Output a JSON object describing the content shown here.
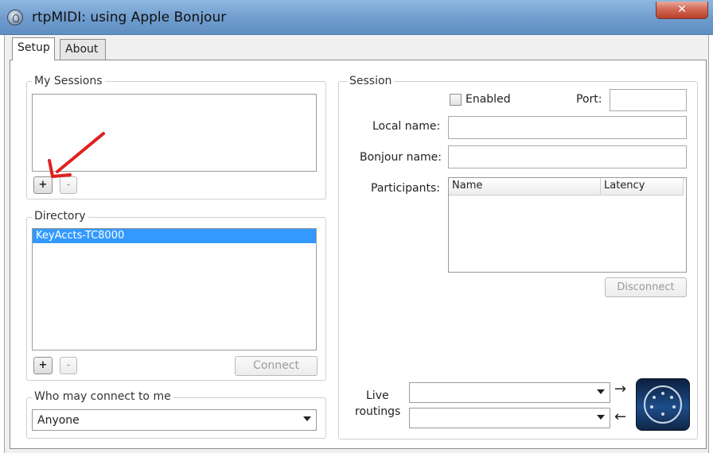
{
  "window": {
    "title": "rtpMIDI: using Apple Bonjour",
    "close_glyph": "✕"
  },
  "tabs": [
    {
      "label": "Setup",
      "active": true
    },
    {
      "label": "About",
      "active": false
    }
  ],
  "my_sessions": {
    "label": "My Sessions",
    "add_label": "+",
    "remove_label": "-",
    "items": []
  },
  "directory": {
    "label": "Directory",
    "items": [
      {
        "name": "KeyAccts-TC8000",
        "selected": true
      }
    ],
    "add_label": "+",
    "remove_label": "-",
    "connect_label": "Connect"
  },
  "who_may_connect": {
    "label": "Who may connect to me",
    "value": "Anyone"
  },
  "session": {
    "label": "Session",
    "enabled_label": "Enabled",
    "enabled": false,
    "port_label": "Port:",
    "port_value": "",
    "local_name_label": "Local name:",
    "local_name_value": "",
    "bonjour_name_label": "Bonjour name:",
    "bonjour_name_value": "",
    "participants_label": "Participants:",
    "participants_columns": [
      "Name",
      "Latency"
    ],
    "participants_rows": [],
    "disconnect_label": "Disconnect"
  },
  "live_routings": {
    "label_line1": "Live",
    "label_line2": "routings",
    "out_value": "",
    "in_value": "",
    "out_arrow": "→",
    "in_arrow": "←"
  },
  "icons": {
    "midi": "midi-connector-icon",
    "app": "rtpmidi-app-icon",
    "annotation": "red-arrow-annotation"
  },
  "colors": {
    "selection": "#3399ff",
    "annotation": "#e02020",
    "titlebar": "#6f9ccd"
  }
}
